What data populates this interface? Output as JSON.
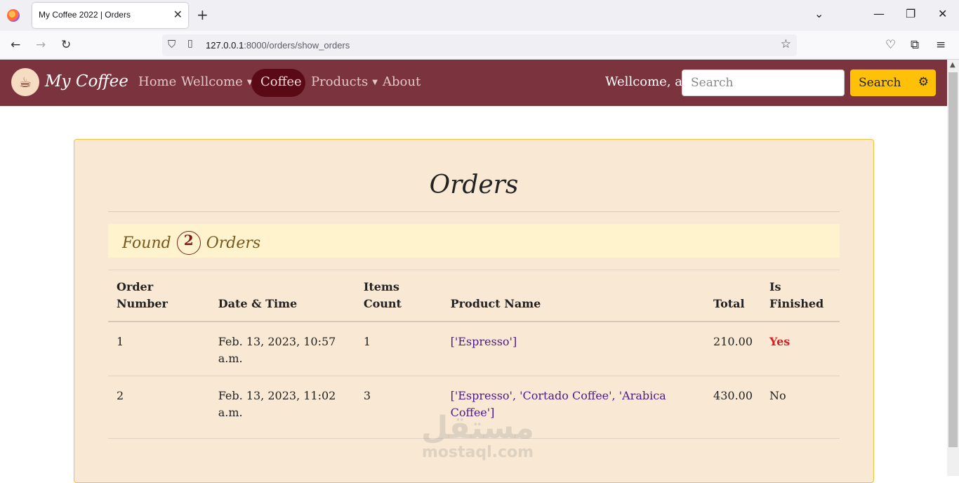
{
  "browser": {
    "tab_title": "My Coffee 2022 | Orders",
    "url_host": "127.0.0.1",
    "url_rest": ":8000/orders/show_orders"
  },
  "site": {
    "brand": "My Coffee",
    "nav": {
      "home": "Home",
      "wellcome": "Wellcome",
      "coffee": "Coffee",
      "products": "Products",
      "about": "About"
    },
    "welcome_text": "Wellcome, ali",
    "search_placeholder": "Search",
    "search_button": "Search"
  },
  "main": {
    "title": "Orders",
    "found_prefix": "Found",
    "found_count": "2",
    "found_suffix": "Orders",
    "table": {
      "headers": {
        "order_number": "Order Number",
        "date_time": "Date & Time",
        "items_count": "Items Count",
        "product_name": "Product Name",
        "total": "Total",
        "is_finished": "Is Finished"
      },
      "rows": [
        {
          "order_number": "1",
          "date_time": "Feb. 13, 2023, 10:57 a.m.",
          "items_count": "1",
          "product_name": "['Espresso']",
          "total": "210.00",
          "is_finished": "Yes"
        },
        {
          "order_number": "2",
          "date_time": "Feb. 13, 2023, 11:02 a.m.",
          "items_count": "3",
          "product_name": "['Espresso', 'Cortado Coffee', 'Arabica Coffee']",
          "total": "430.00",
          "is_finished": "No"
        }
      ]
    },
    "watermark_ar": "مستقل",
    "watermark_en": "mostaql.com"
  },
  "colors": {
    "navbar": "#7b333e",
    "active_pill": "#5a0a14",
    "search_button": "#ffc107",
    "card_bg": "#f9e8d3",
    "found_bg": "#fff3cd",
    "finished_yes": "#e01b24"
  }
}
